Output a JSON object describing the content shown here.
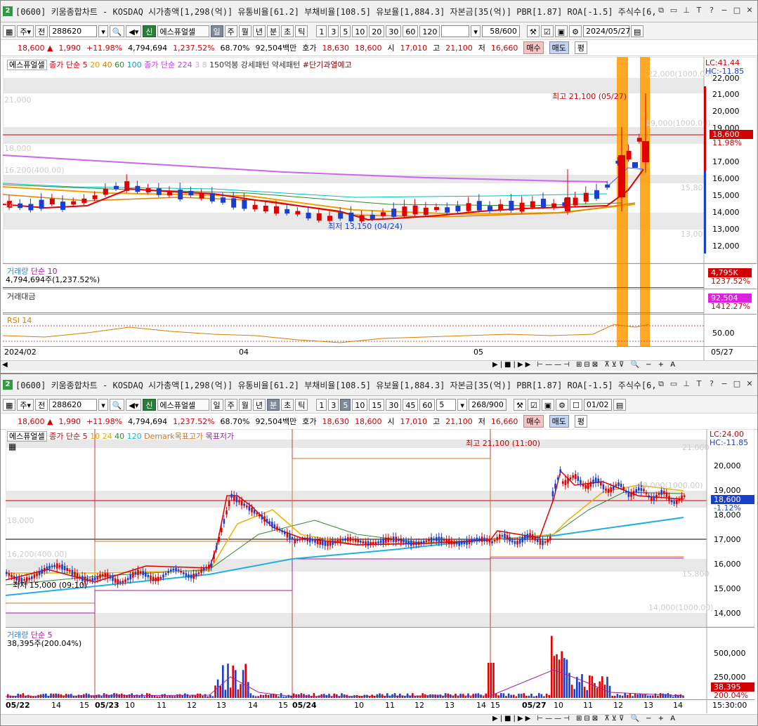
{
  "win1": {
    "num": "2",
    "title": "[0600] 키움종합차트 - KOSDAQ 시가총액[1,298(억)] 유통비율[61.2] 부채비율[108.5] 유보율[1,884.3] 자본금[35(억)] PBR[1.87] ROA[-1.5] 주식수[6,979(천",
    "toolbar": {
      "type": "주",
      "period_label": "전",
      "code": "288620",
      "name_badge": "신",
      "stock_name": "에스퓨얼셀",
      "periods": [
        "일",
        "주",
        "월",
        "년",
        "분",
        "초",
        "틱"
      ],
      "minutes": [
        "1",
        "3",
        "5",
        "10",
        "20",
        "30",
        "60",
        "120"
      ],
      "count": "58/600",
      "date": "2024/05/27"
    },
    "price": {
      "last": "18,600 ▲",
      "change": "1,990",
      "pct": "+11.98%",
      "volume": "4,794,694",
      "vol_pct": "1,237.52%",
      "rate": "68.70%",
      "amount": "92,504백만",
      "hoga": "호가",
      "ask": "18,630",
      "bid": "18,600",
      "open_label": "시",
      "open": "17,010",
      "high_label": "고",
      "high": "21,100",
      "low_label": "저",
      "low": "16,660",
      "buy": "매수",
      "sell": "매도",
      "eval": "평"
    },
    "legend": {
      "name": "에스퓨얼셀",
      "ma_label": "종가 단순 5",
      "ma20": "20",
      "ma40": "40",
      "ma60": "60",
      "ma100": "100",
      "ma224_label": "종가 단순 224",
      "ma3": "3",
      "ma8": "8",
      "pattern": "150억봉 강세패턴",
      "weak": "약세패턴",
      "warn": "#단기과열예고"
    },
    "annot": {
      "high": "최고 21,100 (05/27)",
      "low": "최저 13,150 (04/24)",
      "t22k": "22,000(1000.00)",
      "t19k": "19,000(1000.00)",
      "t21k": "21,000",
      "t18k": "18,000",
      "t16k": "16,200(400.00)",
      "t15k8": "15,80",
      "t13k": "13,00",
      "t14k": "14"
    },
    "yaxis": [
      "22,000",
      "21,000",
      "20,000",
      "19,000",
      "18,000",
      "17,000",
      "16,000",
      "15,000",
      "14,000",
      "13,000",
      "12,000"
    ],
    "lc": "LC:41.44",
    "hc": "HC:-11.85",
    "cur_price": "18,600",
    "cur_pct": "11.98%",
    "vol_label": "거래량",
    "vol_ma": "단순 10",
    "vol_val": "4,794,694주(1,237.52%)",
    "vol_tag": "4,795K",
    "vol_tag_pct": "1237.52%",
    "amt_label": "거래대금",
    "amt_tag": "92,504",
    "amt_tag_pct": "1412.27%",
    "rsi_label": "RSI 14",
    "rsi_tick": "50.00",
    "xaxis": [
      "2024/02",
      "04",
      "05"
    ],
    "xright": "05/27"
  },
  "win2": {
    "num": "2",
    "title": "[0600] 키움종합차트 - KOSDAQ 시가총액[1,298(억)] 유통비율[61.2] 부채비율[108.5] 유보율[1,884.3] 자본금[35(억)] PBR[1.87] ROA[-1.5] 주식수[6,979(천",
    "toolbar": {
      "type": "주",
      "period_label": "전",
      "code": "288620",
      "name_badge": "신",
      "stock_name": "에스퓨얼셀",
      "periods": [
        "일",
        "주",
        "월",
        "년",
        "분",
        "초",
        "틱"
      ],
      "minutes": [
        "1",
        "3",
        "5",
        "10",
        "15",
        "30",
        "45",
        "60"
      ],
      "min_sel": "5",
      "count": "268/900",
      "date": "01/02"
    },
    "price": {
      "last": "18,600 ▲",
      "change": "1,990",
      "pct": "+11.98%",
      "volume": "4,794,694",
      "vol_pct": "1,237.52%",
      "rate": "68.70%",
      "amount": "92,504백만",
      "hoga": "호가",
      "ask": "18,630",
      "bid": "18,600",
      "open_label": "시",
      "open": "17,010",
      "high_label": "고",
      "high": "21,100",
      "low_label": "저",
      "low": "16,660",
      "buy": "매수",
      "sell": "매도",
      "eval": "평"
    },
    "legend": {
      "name": "에스퓨얼셀",
      "ma_label": "종가 단순 5",
      "ma10": "10",
      "ma24": "24",
      "ma40": "40",
      "ma120": "120",
      "demark": "Demark목표고가",
      "target_low": "목표저가"
    },
    "annot": {
      "high": "최고 21,100 (11:00)",
      "low": "최저 15,000 (09:10)",
      "t21k": "21,000",
      "t19k": "19,000(1000.00)",
      "t18k": "18,000",
      "t16k": "16,200(400.00)",
      "t15k8": "15,800",
      "t14k": "14,000(1000.00)"
    },
    "yaxis": [
      "20,000",
      "19,000",
      "18,000",
      "17,000",
      "16,000",
      "15,000",
      "14,000"
    ],
    "lc": "LC:24.00",
    "hc": "HC:-11.85",
    "cur_price": "18,600",
    "cur_pct": "-1.12%",
    "vol_label": "거래량",
    "vol_ma": "단순 5",
    "vol_val": "38,395주(200.04%)",
    "vol_axis": [
      "500,000",
      "250,000"
    ],
    "vol_tag": "38,395",
    "vol_tag_pct": "200.04%",
    "xaxis": [
      "05/22",
      "14",
      "15",
      "05/23",
      "10",
      "11",
      "12",
      "13",
      "14",
      "15",
      "05/24",
      "10",
      "11",
      "12",
      "13",
      "14",
      "15",
      "05/27",
      "10",
      "11",
      "12",
      "13",
      "14",
      "15"
    ],
    "xright": "15:30:00"
  }
}
